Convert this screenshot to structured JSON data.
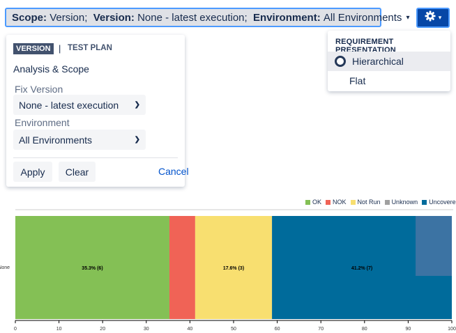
{
  "scope_bar": {
    "scope_key": "Scope:",
    "scope_value": "Version;",
    "version_key": "Version:",
    "version_value": "None - latest execution;",
    "environment_key": "Environment:",
    "environment_value": "All Environments",
    "caret": "▾"
  },
  "gear_menu": {
    "gear_icon": "gear-icon",
    "caret": "▾",
    "heading": "REQUIREMENT PRESENTATION",
    "items": [
      {
        "label": "Hierarchical",
        "selected": true
      },
      {
        "label": "Flat",
        "selected": false
      }
    ]
  },
  "scope_popup": {
    "tabs": [
      {
        "label": "VERSION",
        "active": true
      },
      {
        "label": "TEST PLAN",
        "active": false
      }
    ],
    "separator": "|",
    "section_title": "Analysis & Scope",
    "fix_version_label": "Fix Version",
    "fix_version_value": "None - latest execution",
    "environment_label": "Environment",
    "environment_value": "All Environments",
    "apply_label": "Apply",
    "clear_label": "Clear",
    "cancel_label": "Cancel"
  },
  "colors": {
    "ok": "#84c055",
    "nok": "#f06356",
    "not_run": "#f8df70",
    "unknown": "#a0a0a0",
    "uncovered": "#006b9b",
    "accent": "#0747a6"
  },
  "chart_data": {
    "type": "bar",
    "orientation": "horizontal",
    "stacked": true,
    "categories": [
      "None"
    ],
    "series": [
      {
        "name": "OK",
        "values": [
          35.3
        ],
        "label": "35.3% (6)"
      },
      {
        "name": "NOK",
        "values": [
          5.9
        ],
        "label": ""
      },
      {
        "name": "Not Run",
        "values": [
          17.6
        ],
        "label": "17.6% (3)"
      },
      {
        "name": "Unknown",
        "values": [
          0
        ],
        "label": ""
      },
      {
        "name": "Uncovered",
        "values": [
          41.2
        ],
        "label": "41.2% (7)"
      }
    ],
    "xlim": [
      0,
      100
    ],
    "xticks": [
      0,
      10,
      20,
      30,
      40,
      50,
      60,
      70,
      80,
      90,
      100
    ],
    "legend_position": "top-right"
  }
}
